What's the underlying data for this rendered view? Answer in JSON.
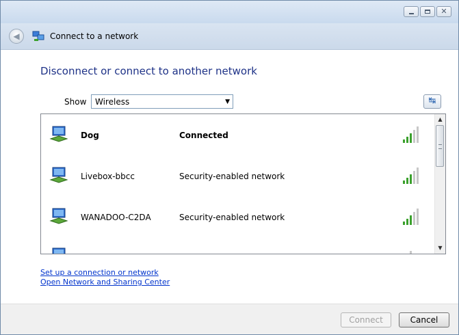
{
  "window": {
    "nav_title": "Connect to a network",
    "controls": {
      "close_glyph": "✕"
    }
  },
  "heading": "Disconnect or connect to another network",
  "filter": {
    "label": "Show",
    "selected": "Wireless"
  },
  "networks": [
    {
      "name": "Dog",
      "status": "Connected",
      "bold": true,
      "signal_bars": 5
    },
    {
      "name": "Livebox-bbcc",
      "status": "Security-enabled network",
      "bold": false,
      "signal_bars": 5
    },
    {
      "name": "WANADOO-C2DA",
      "status": "Security-enabled network",
      "bold": false,
      "signal_bars": 5
    }
  ],
  "links": {
    "setup": "Set up a connection or network",
    "sharing_center": "Open Network and Sharing Center"
  },
  "buttons": {
    "connect": "Connect",
    "cancel": "Cancel"
  },
  "colors": {
    "heading": "#1e3287",
    "link": "#0033cc",
    "signal_active": "#3aa02c",
    "signal_inactive": "#c8c8c8"
  }
}
